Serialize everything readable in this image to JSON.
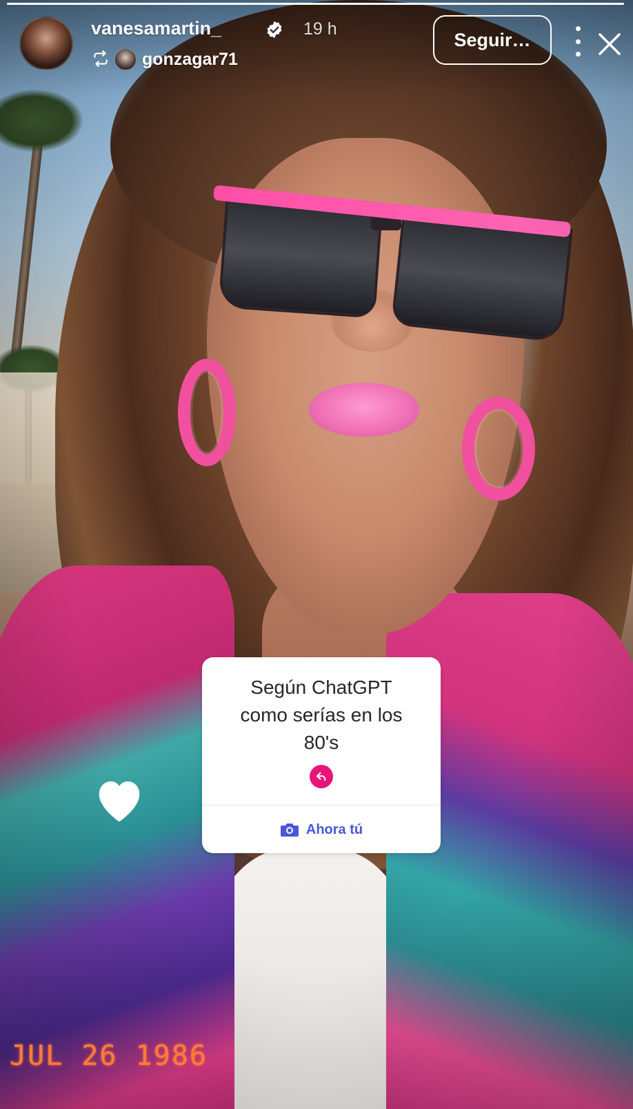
{
  "story": {
    "progress": 1.0,
    "user": {
      "username": "vanesamartin_",
      "verified": true,
      "timestamp": "19 h",
      "avatar_icon": "profile-avatar"
    },
    "repost": {
      "icon": "repost-icon",
      "username": "gonzagar71"
    },
    "follow_button": "Seguir…",
    "more_icon": "more-dots-icon",
    "close_icon": "close-icon"
  },
  "sticker": {
    "text": "Según ChatGPT\ncomo serías en los\n80's",
    "reply_icon": "reply-arrow-icon",
    "action_icon": "camera-icon",
    "action_label": "Ahora tú",
    "accent_color": "#e6157a",
    "action_color": "#4a57d9"
  },
  "overlay": {
    "heart_icon": "heart-icon",
    "date_stamp": "JUL 26 1986"
  }
}
